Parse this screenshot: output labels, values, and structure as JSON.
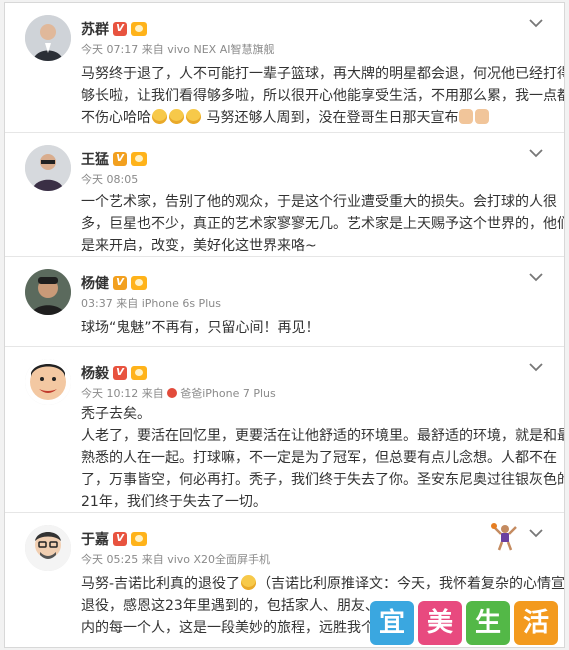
{
  "posts": [
    {
      "name": "苏群",
      "badge": "V",
      "time": "今天 07:17",
      "source_prefix": "来自",
      "source": "vivo NEX AI智慧旗舰",
      "lines": [
        "马努终于退了，人不可能打一辈子篮球，再大牌的明星都会退，何况他已经打得",
        "够长啦，让我们看得够多啦，所以很开心他能享受生活，不用那么累，我一点都",
        "不伤心哈哈",
        "马努还够人周到，没在登哥生日那天宣布"
      ]
    },
    {
      "name": "王猛",
      "badge": "V",
      "time": "今天 08:05",
      "lines": [
        "一个艺术家，告别了他的观众，于是这个行业遭受重大的损失。会打球的人很",
        "多，巨星也不少，真正的艺术家寥寥无几。艺术家是上天赐予这个世界的，他们",
        "是来开启，改变，美好化这世界来咯~"
      ]
    },
    {
      "name": "杨健",
      "badge": "V",
      "time": "03:37",
      "source_prefix": "来自",
      "source": "iPhone 6s Plus",
      "lines": [
        "球场“鬼魅”不再有，只留心间！再见！"
      ]
    },
    {
      "name": "杨毅",
      "badge": "V",
      "time": "今天 10:12",
      "source_prefix": "来自",
      "source": "爸爸iPhone 7 Plus",
      "lines": [
        "秃子去矣。",
        "人老了，要活在回忆里，更要活在让他舒适的环境里。最舒适的环境，就是和最",
        "熟悉的人在一起。打球嘛，不一定是为了冠军，但总要有点儿念想。人都不在",
        "了，万事皆空，何必再打。秃子，我们终于失去了你。圣安东尼奥过往银灰色的",
        "21年，我们终于失去了一切。"
      ]
    },
    {
      "name": "于嘉",
      "badge": "V",
      "time": "今天 05:25",
      "source_prefix": "来自",
      "source": "vivo X20全面屏手机",
      "lines": [
        "马努-吉诺比利真的退役了",
        "（吉诺比利原推译文：今天，我怀着复杂的心情宣布",
        "退役，感恩这23年里遇到的，包括家人、朋友、",
        "内的每一个人，这是一段美妙的旅程，远胜我个人"
      ]
    }
  ],
  "watermark": {
    "chars": [
      "宜",
      "美",
      "生",
      "活"
    ],
    "colors": [
      "#3aa7e0",
      "#e84a7f",
      "#53b847",
      "#f39a1e"
    ]
  },
  "colors": {
    "accent_orange": "#f2a01f",
    "verified_red": "#e8533f",
    "meta_gray": "#8a8a8a"
  }
}
